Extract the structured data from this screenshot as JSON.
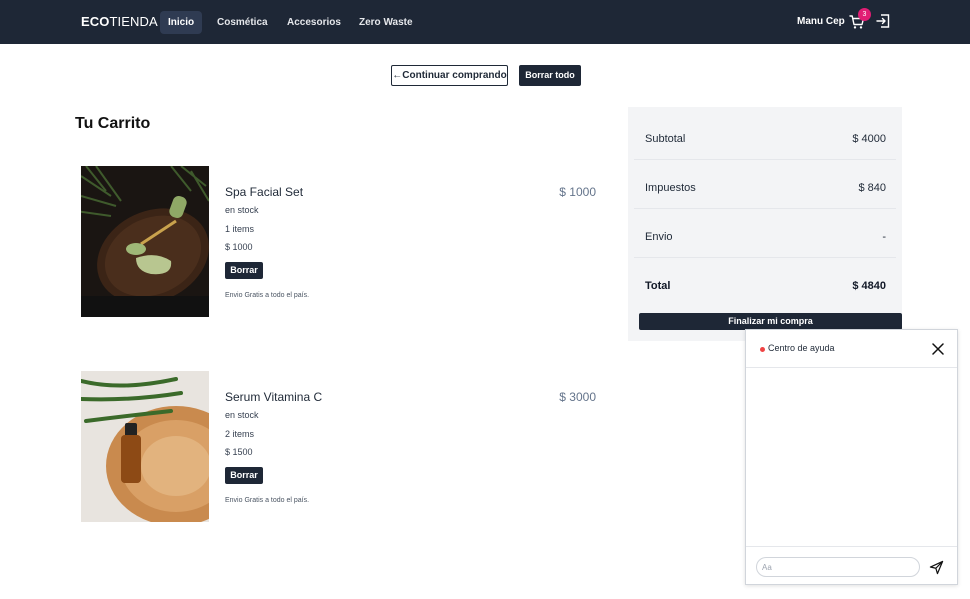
{
  "navbar": {
    "brand_bold": "ECO",
    "brand_rest": "TIENDA",
    "links": [
      "Inicio",
      "Cosmética",
      "Accesorios",
      "Zero Waste"
    ],
    "user_name": "Manu Cep",
    "cart_count": "3",
    "icons": {
      "cart": "cart-icon",
      "logout": "logout-icon"
    }
  },
  "actions": {
    "continue_label": "←Continuar comprando",
    "clear_all_label": "Borrar todo"
  },
  "cart": {
    "title": "Tu Carrito",
    "items": [
      {
        "name": "Spa Facial Set",
        "stock": "en stock",
        "quantity": "1 items",
        "unit_price": "$ 1000",
        "total": "$ 1000",
        "delete_label": "Borrar",
        "shipping": "Envio Gratis a todo el país."
      },
      {
        "name": "Serum Vitamina C",
        "stock": "en stock",
        "quantity": "2 items",
        "unit_price": "$ 1500",
        "total": "$ 3000",
        "delete_label": "Borrar",
        "shipping": "Envio Gratis a todo el país."
      }
    ]
  },
  "summary": {
    "rows": [
      {
        "label": "Subtotal",
        "value": "$ 4000"
      },
      {
        "label": "Impuestos",
        "value": "$ 840"
      },
      {
        "label": "Envio",
        "value": "-"
      },
      {
        "label": "Total",
        "value": "$ 4840"
      }
    ],
    "checkout_label": "Finalizar mi compra"
  },
  "help": {
    "title": "Centro de ayuda",
    "input_placeholder": "Aa",
    "status_color": "#ef4444"
  },
  "colors": {
    "navbar": "#1e2736",
    "badge": "#e11d74",
    "summary_bg": "#f3f4f6"
  }
}
